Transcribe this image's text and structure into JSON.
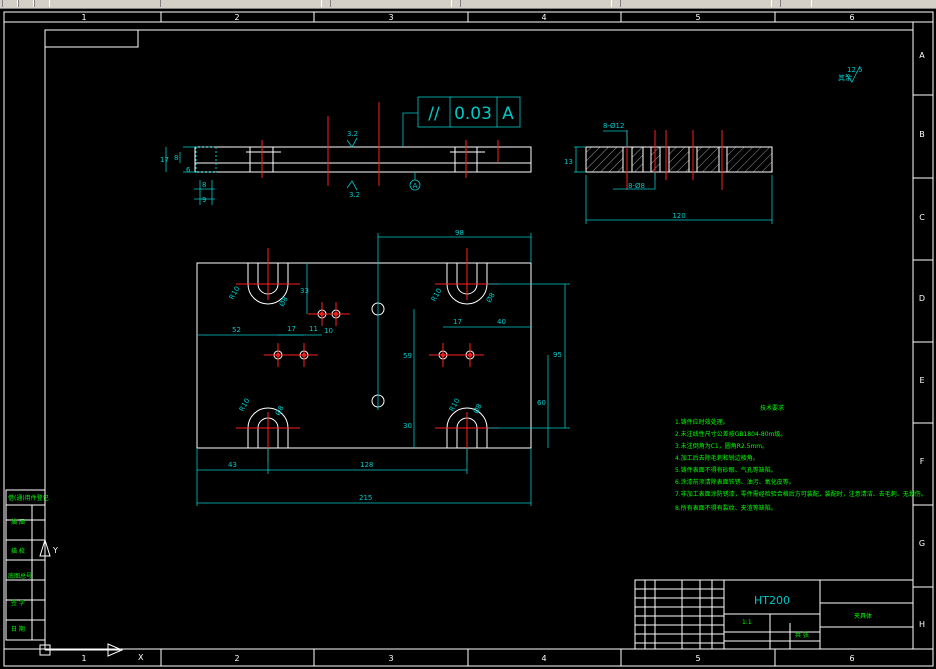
{
  "ruler_top": [
    "1",
    "2",
    "3",
    "4",
    "5",
    "6"
  ],
  "ruler_bottom": [
    "1",
    "2",
    "3",
    "4",
    "5",
    "6"
  ],
  "ruler_right": [
    "A",
    "B",
    "C",
    "D",
    "E",
    "F",
    "G",
    "H"
  ],
  "tolerance": {
    "symbol": "//",
    "value": "0.03",
    "datum": "A"
  },
  "datum_label": "A",
  "roughness_main": "3.2",
  "roughness_lower": "3.2",
  "roughness_corner": "其余",
  "roughness_corner_value": "12.5",
  "front_dims": {
    "total_h": "17",
    "h1": "8",
    "h2": "6",
    "w1": "8",
    "w2": "9"
  },
  "side_dims": {
    "top": "8-Ø12",
    "bottom": "8-Ø8",
    "height": "13",
    "width": "120"
  },
  "plan_dims": {
    "d98": "98",
    "d33": "33",
    "d52": "52",
    "d17a": "17",
    "d11": "11",
    "d10": "10",
    "d17b": "17",
    "d40": "40",
    "d59": "59",
    "d95": "95",
    "d60": "60",
    "d30": "30",
    "d43": "43",
    "d128": "128",
    "d215": "215",
    "r_tl": "R10",
    "r_tl2": "Ø8",
    "r_tr": "R10",
    "r_tr2": "Ø8",
    "r_bl": "R10",
    "r_bl2": "Ø8",
    "r_br": "R10",
    "r_br2": "Ø8"
  },
  "notes": {
    "title": "技术要求",
    "lines": [
      "1.铸件应时效处理。",
      "2.未注线性尺寸公差按GB1804-80m级。",
      "3.未注倒角为C1，圆角R2.5mm。",
      "4.加工后去除毛刺和锐边棱角。",
      "5.铸件表面不得有砂眼、气孔等缺陷。",
      "6.涂漆前须清除表面铁锈、油污、氧化皮等。",
      "7.非加工表面涂防锈漆，零件需经检验合格后方可装配，装配时，注意清洁、去毛刺、无划伤。",
      "8.所有表面不得有裂纹、夹渣等缺陷。"
    ]
  },
  "side_labels": [
    "借(通)用件登记",
    "描 图",
    "描 校",
    "底图总号",
    "签 字",
    "日 期"
  ],
  "title_block": {
    "material": "HT200",
    "part_name": "夹具体",
    "scale": "1:1",
    "sheet": "共 张"
  },
  "ucs": {
    "y": "Y",
    "x": "X"
  }
}
